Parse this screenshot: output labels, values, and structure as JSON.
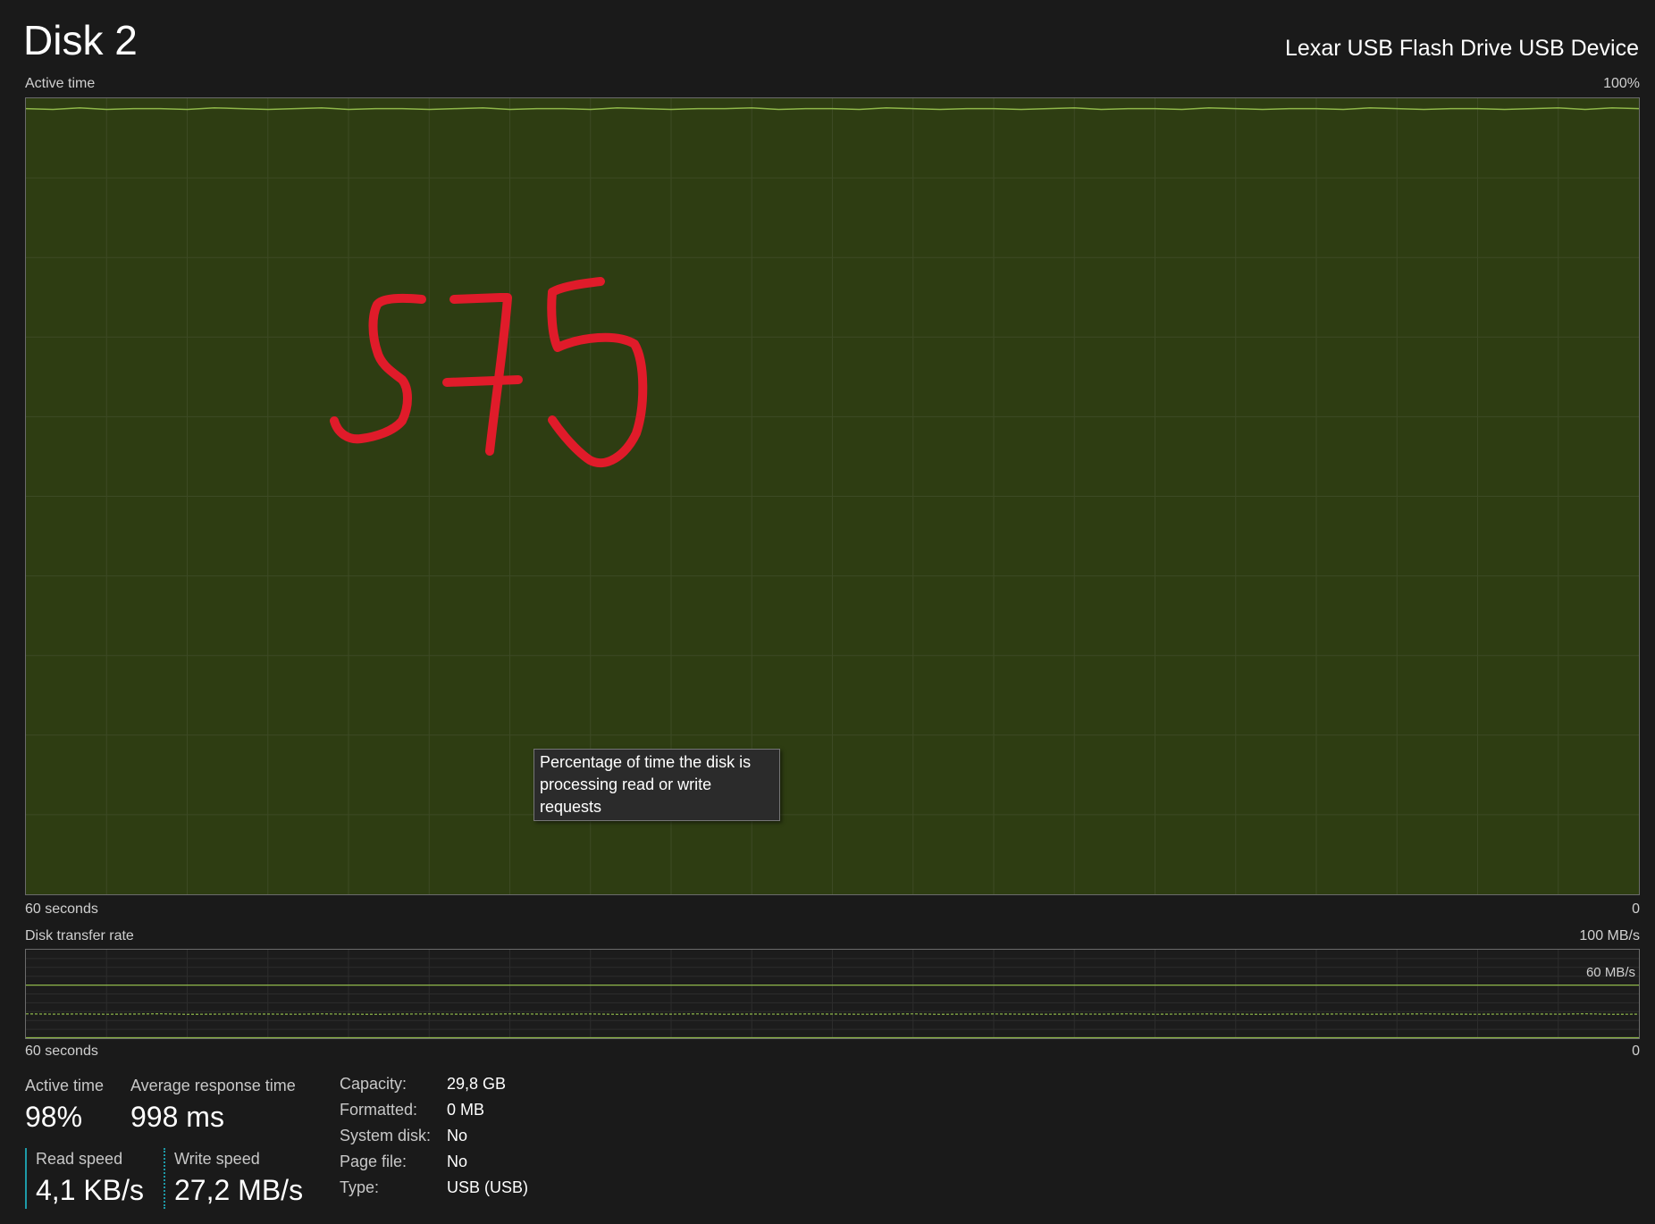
{
  "header": {
    "title": "Disk 2",
    "device_name": "Lexar USB Flash Drive USB Device"
  },
  "active_time_graph": {
    "label": "Active time",
    "max_label": "100%",
    "time_label": "60 seconds",
    "zero_label": "0",
    "tooltip_line1": "Percentage of time the disk is",
    "tooltip_line2": "processing read or write requests",
    "fill_color": "#2e3d12",
    "line_color": "#8fb84a",
    "grid_color": "#3d4a24"
  },
  "transfer_graph": {
    "label": "Disk transfer rate",
    "max_label": "100 MB/s",
    "ref_label": "60 MB/s",
    "time_label": "60 seconds",
    "zero_label": "0",
    "line_color": "#8fb84a"
  },
  "annotation": {
    "handwritten_text": "575",
    "color": "#e01b2a"
  },
  "chart_data": [
    {
      "type": "area",
      "title": "Active time",
      "ylim": [
        0,
        100
      ],
      "x_range_seconds": [
        60,
        0
      ],
      "series": [
        {
          "values": [
            98.7,
            98.6,
            98.8,
            98.6,
            98.7,
            98.7,
            98.6,
            98.8,
            98.7,
            98.6,
            98.7,
            98.8,
            98.6,
            98.7,
            98.7,
            98.6,
            98.7,
            98.8,
            98.6,
            98.7,
            98.7,
            98.6,
            98.8,
            98.7,
            98.6,
            98.7,
            98.7,
            98.8,
            98.6,
            98.7,
            98.7,
            98.6,
            98.8,
            98.7,
            98.6,
            98.7,
            98.7,
            98.6,
            98.7,
            98.8,
            98.6,
            98.7,
            98.7,
            98.6,
            98.8,
            98.7,
            98.6,
            98.7,
            98.7,
            98.6,
            98.8,
            98.7,
            98.6,
            98.7,
            98.7,
            98.6,
            98.7,
            98.8,
            98.6,
            98.8,
            98.7
          ]
        }
      ],
      "grid": true
    },
    {
      "type": "line",
      "title": "Disk transfer rate",
      "ylim": [
        0,
        100
      ],
      "x_range_seconds": [
        60,
        0
      ],
      "reference_line": 60,
      "series": [
        {
          "name": "Write speed",
          "style": "dashed",
          "values": [
            27.5,
            27.2,
            27.4,
            27.1,
            27.3,
            27.6,
            27.0,
            27.2,
            27.4,
            27.3,
            27.1,
            27.5,
            27.2,
            27.0,
            27.3,
            27.4,
            27.2,
            27.1,
            27.5,
            27.3,
            27.2,
            27.4,
            27.0,
            27.3,
            27.2,
            27.5,
            27.1,
            27.3,
            27.2,
            27.4,
            27.3,
            27.1,
            27.2,
            27.5,
            27.0,
            27.3,
            27.4,
            27.2,
            27.1,
            27.3,
            27.2,
            27.5,
            27.1,
            27.3,
            27.4,
            27.2,
            27.0,
            27.3,
            27.2,
            27.4,
            27.1,
            27.3,
            27.5,
            27.2,
            27.1,
            27.3,
            27.4,
            27.2,
            27.6,
            27.0,
            27.2
          ]
        },
        {
          "name": "Read speed",
          "style": "solid",
          "values": [
            0,
            0,
            0,
            0,
            0,
            0,
            0,
            0,
            0,
            0,
            0,
            0,
            0,
            0,
            0,
            0,
            0,
            0,
            0,
            0,
            0,
            0,
            0,
            0,
            0,
            0,
            0,
            0,
            0,
            0,
            0,
            0,
            0,
            0,
            0,
            0,
            0,
            0,
            0,
            0,
            0,
            0,
            0,
            0,
            0,
            0,
            0,
            0,
            0,
            0,
            0,
            0,
            0,
            0,
            0,
            0,
            0,
            0,
            0,
            0,
            0
          ]
        }
      ],
      "grid": true
    }
  ],
  "stats": {
    "active_time_label": "Active time",
    "active_time_value": "98%",
    "avg_response_label": "Average response time",
    "avg_response_value": "998 ms",
    "read_speed_label": "Read speed",
    "read_speed_value": "4,1 KB/s",
    "write_speed_label": "Write speed",
    "write_speed_value": "27,2 MB/s"
  },
  "info": [
    {
      "label": "Capacity:",
      "value": "29,8 GB"
    },
    {
      "label": "Formatted:",
      "value": "0 MB"
    },
    {
      "label": "System disk:",
      "value": "No"
    },
    {
      "label": "Page file:",
      "value": "No"
    },
    {
      "label": "Type:",
      "value": "USB (USB)"
    }
  ]
}
